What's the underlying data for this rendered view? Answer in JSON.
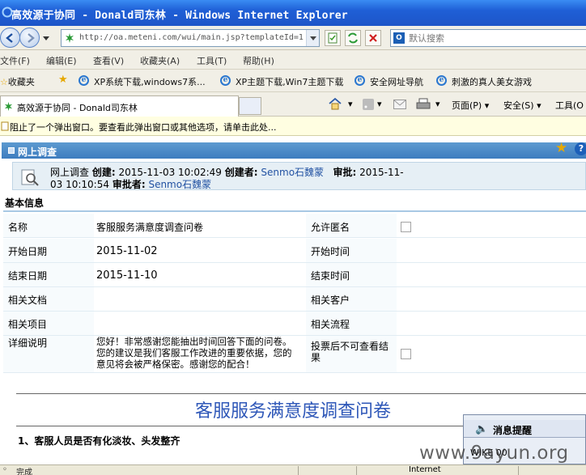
{
  "window": {
    "title": "高效源于协同 - Donald司东林 - Windows Internet Explorer"
  },
  "address_bar": {
    "url": "http://oa.meteni.com/wui/main.jsp?templateId=1",
    "search_placeholder": "默认搜索"
  },
  "menu": [
    "文件(F)",
    "编辑(E)",
    "查看(V)",
    "收藏夹(A)",
    "工具(T)",
    "帮助(H)"
  ],
  "favorites_bar": {
    "label": "收藏夹",
    "items": [
      "XP系统下载,windows7系...",
      "XP主题下载,Win7主题下载",
      "安全网址导航",
      "刺激的真人美女游戏"
    ]
  },
  "tab": {
    "title": "高效源于协同 - Donald司东林"
  },
  "command_bar": {
    "page": "页面(P)",
    "safety": "安全(S)",
    "tools": "工具(O"
  },
  "infobar": {
    "text": "阻止了一个弹出窗口。要查看此弹出窗口或其他选项，请单击此处..."
  },
  "panel": {
    "title": "网上调查"
  },
  "doc_info": {
    "module": "网上调查",
    "created_label": "创建:",
    "created_value": "2015-11-03  10:02:49",
    "creator_label": "创建者:",
    "creator": "Senmo石魏蒙",
    "approved_label": "审批:",
    "approved_date": "2015-11-",
    "approved_rest": "03  10:10:54",
    "approver_label": "审批者:",
    "approver": "Senmo石魏蒙"
  },
  "basic_info": {
    "title": "基本信息",
    "rows": {
      "name_label": "名称",
      "name_value": "客服服务满意度调查问卷",
      "anon_label": "允许匿名",
      "start_label": "开始日期",
      "start_value": "2015-11-02",
      "start_time_label": "开始时间",
      "end_label": "结束日期",
      "end_value": "2015-11-10",
      "end_time_label": "结束时间",
      "doc_label": "相关文档",
      "customer_label": "相关客户",
      "project_label": "相关项目",
      "flow_label": "相关流程",
      "detail_label": "详细说明",
      "detail_value_1": "您好！非常感谢您能抽出时间回答下面的问卷。",
      "detail_value_2": "您的建议是我们客服工作改进的重要依据，您的",
      "detail_value_3": "意见将会被严格保密。感谢您的配合！",
      "vote_label_1": "投票后不可查看结",
      "vote_label_2": "果"
    }
  },
  "survey": {
    "title": "客服服务满意度调查问卷",
    "question1": "1、客服人员是否有化淡妆、头发整齐"
  },
  "popup": {
    "title": "消息提醒",
    "body": "WIKE 00"
  },
  "watermark": "www.9ayun.org",
  "status": {
    "text": "完成",
    "zone": "Internet"
  }
}
